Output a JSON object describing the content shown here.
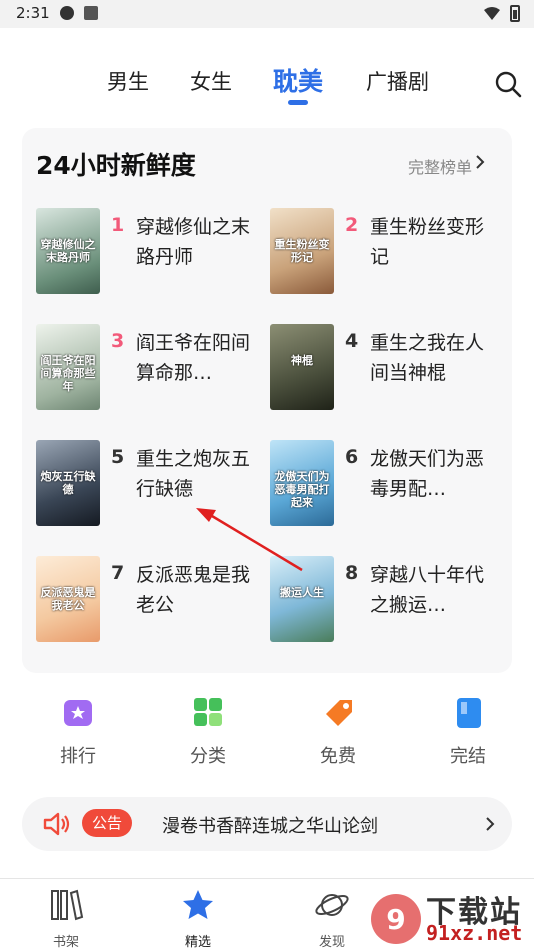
{
  "status_bar": {
    "time": "2:31"
  },
  "tabs": [
    {
      "label": "男生",
      "active": false
    },
    {
      "label": "女生",
      "active": false
    },
    {
      "label": "耽美",
      "active": true
    },
    {
      "label": "广播剧",
      "active": false
    }
  ],
  "ranking": {
    "title": "24小时新鲜度",
    "more_label": "完整榜单",
    "books": [
      {
        "rank": "1",
        "title": "穿越修仙之末路丹师",
        "cover_text": "穿越修仙之末路丹师",
        "cover_color": "#6a8f7a"
      },
      {
        "rank": "2",
        "title": "重生粉丝变形记",
        "cover_text": "重生粉丝变形记",
        "cover_color": "#c9a27a"
      },
      {
        "rank": "3",
        "title": "阎王爷在阳间算命那…",
        "cover_text": "阎王爷在阳间算命那些年",
        "cover_color": "#9fb3a0"
      },
      {
        "rank": "4",
        "title": "重生之我在人间当神棍",
        "cover_text": "神棍",
        "cover_color": "#4a4f3c"
      },
      {
        "rank": "5",
        "title": "重生之炮灰五行缺德",
        "cover_text": "炮灰五行缺德",
        "cover_color": "#3a4656"
      },
      {
        "rank": "6",
        "title": "龙傲天们为恶毒男配…",
        "cover_text": "龙傲天们为恶毒男配打起来",
        "cover_color": "#5aa7d6"
      },
      {
        "rank": "7",
        "title": "反派恶鬼是我老公",
        "cover_text": "反派恶鬼是我老公",
        "cover_color": "#f4c9a0"
      },
      {
        "rank": "8",
        "title": "穿越八十年代之搬运…",
        "cover_text": "搬运人生",
        "cover_color": "#7fb8d8"
      }
    ]
  },
  "shortcuts": [
    {
      "label": "排行",
      "icon": "trophy-icon",
      "color": "#a16bf2"
    },
    {
      "label": "分类",
      "icon": "grid-icon",
      "color": "#45c05a"
    },
    {
      "label": "免费",
      "icon": "tag-icon",
      "color": "#f57a24"
    },
    {
      "label": "完结",
      "icon": "book-icon",
      "color": "#2e8cf0"
    }
  ],
  "notice": {
    "badge": "公告",
    "text": "漫卷书香醉连城之华山论剑"
  },
  "bottom_nav": [
    {
      "label": "书架",
      "icon": "bookshelf-icon",
      "active": false
    },
    {
      "label": "精选",
      "icon": "star-icon",
      "active": true
    },
    {
      "label": "发现",
      "icon": "planet-icon",
      "active": false
    }
  ],
  "watermark": {
    "title": "下载站",
    "sub": "91xz.net"
  },
  "colors": {
    "accent": "#2e6fe6",
    "rank_hot": "#f25a7a",
    "notice_red": "#f04a3a"
  }
}
